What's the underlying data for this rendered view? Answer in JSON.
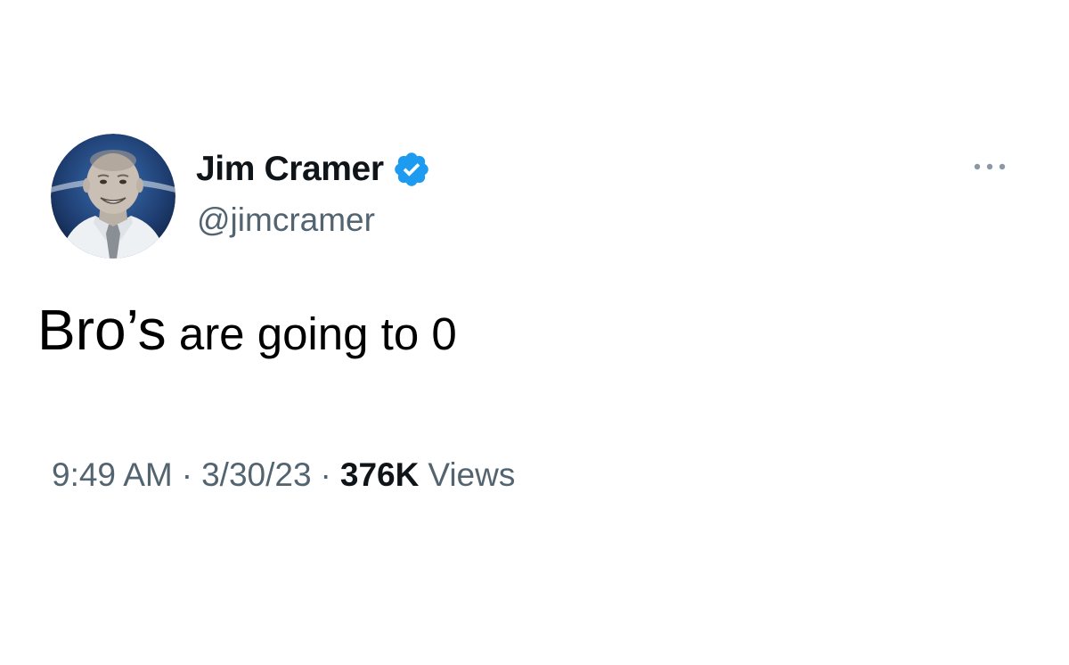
{
  "author": {
    "display_name": "Jim Cramer",
    "handle": "@jimcramer",
    "verified": true,
    "avatar_icon": "profile-photo",
    "verified_icon": "verified-checkmark-icon"
  },
  "tweet": {
    "text_part1": "Bro’s",
    "text_part2": " are going to 0"
  },
  "meta": {
    "time": "9:49 AM",
    "separator": "·",
    "date": "3/30/23",
    "views_count": "376K",
    "views_label": "Views"
  },
  "more_icon": "more-dots-icon",
  "colors": {
    "accent": "#1d9bf0",
    "text_primary": "#0f1419",
    "text_secondary": "#536471",
    "background": "#ffffff"
  }
}
